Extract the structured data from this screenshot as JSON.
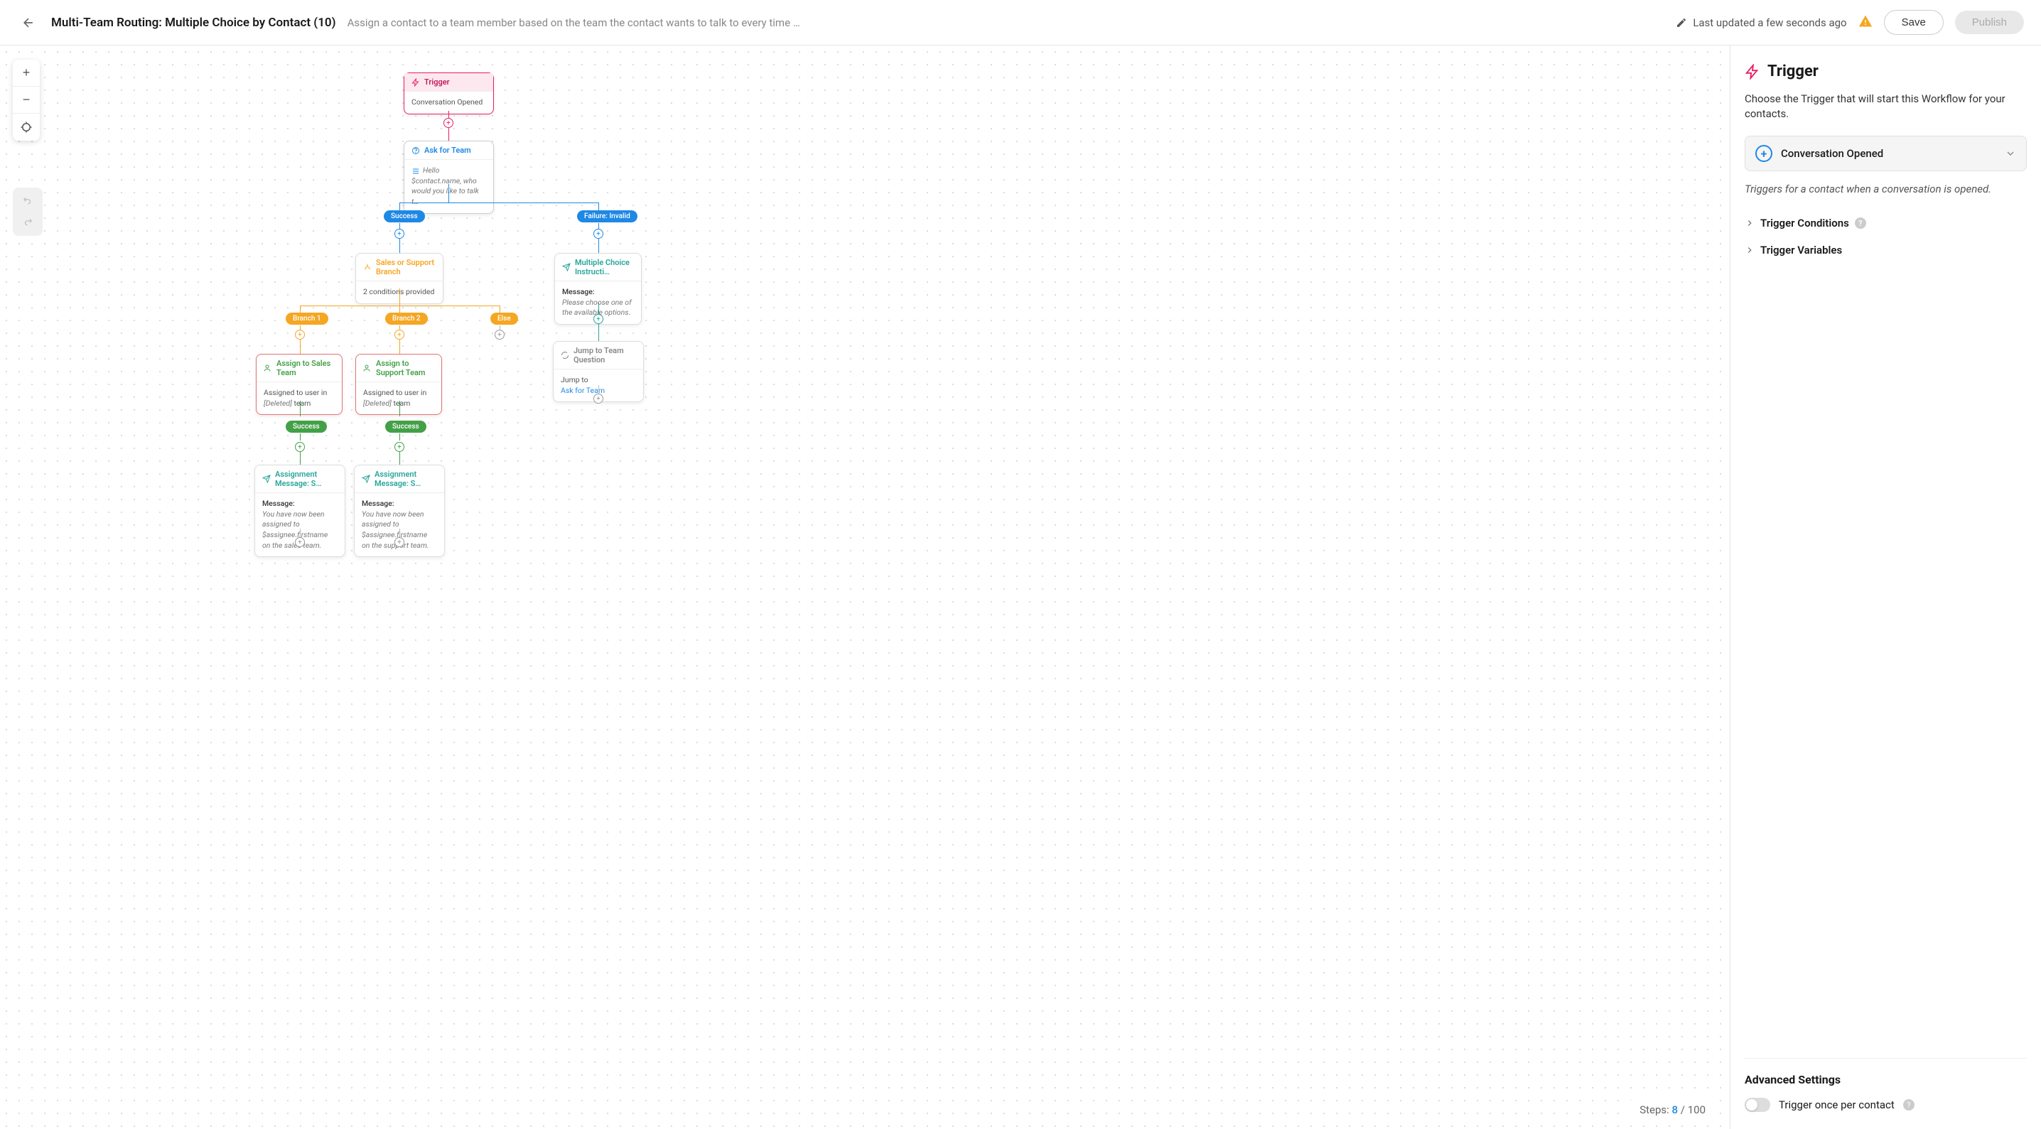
{
  "header": {
    "title": "Multi-Team Routing: Multiple Choice by Contact (10)",
    "subtitle": "Assign a contact to a team member based on the team the contact wants to talk to every time …",
    "updated": "Last updated a few seconds ago",
    "save": "Save",
    "publish": "Publish"
  },
  "canvas": {
    "trigger": {
      "title": "Trigger",
      "body": "Conversation Opened"
    },
    "ask": {
      "title": "Ask for Team",
      "body": "Hello $contact.name, who would you like to talk t…"
    },
    "pill_success": "Success",
    "pill_failure": "Failure: Invalid",
    "branch": {
      "title": "Sales or Support Branch",
      "body": "2 conditions provided"
    },
    "instr": {
      "title": "Multiple Choice Instructi…",
      "msg_lbl": "Message:",
      "msg": "Please choose one of the available options."
    },
    "pill_b1": "Branch 1",
    "pill_b2": "Branch 2",
    "pill_else": "Else",
    "assign_sales": {
      "title": "Assign to Sales Team",
      "pre": "Assigned to user in ",
      "del": "[Deleted]",
      "suf": " team"
    },
    "assign_support": {
      "title": "Assign to Support Team",
      "pre": "Assigned to user in ",
      "del": "[Deleted]",
      "suf": " team"
    },
    "jump": {
      "title": "Jump to Team Question",
      "lbl": "Jump to",
      "target": "Ask for Team"
    },
    "pill_success2": "Success",
    "msg_sales": {
      "title": "Assignment Message: S…",
      "lbl": "Message:",
      "body": "You have now been assigned to $assignee.firstname on the sales team."
    },
    "msg_support": {
      "title": "Assignment Message: S…",
      "lbl": "Message:",
      "body": "You have now been assigned to $assignee.firstname on the support team."
    },
    "steps_lbl": "Steps:",
    "steps_cur": "8",
    "steps_sep": " / ",
    "steps_max": "100"
  },
  "sidebar": {
    "title": "Trigger",
    "desc": "Choose the Trigger that will start this Workflow for your contacts.",
    "selected": "Conversation Opened",
    "note": "Triggers for a contact when a conversation is opened.",
    "cond": "Trigger Conditions",
    "vars": "Trigger Variables",
    "adv_title": "Advanced Settings",
    "toggle_lbl": "Trigger once per contact"
  }
}
